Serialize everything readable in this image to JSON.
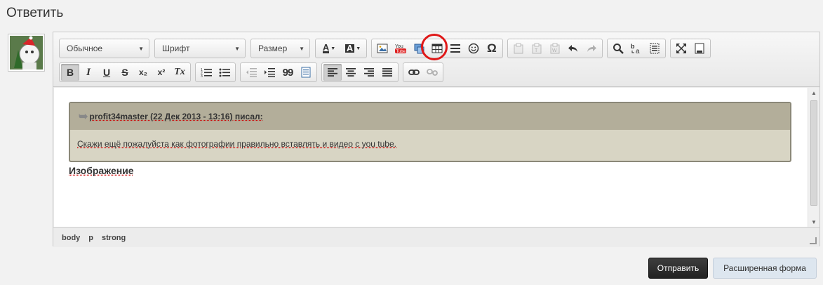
{
  "page": {
    "title": "Ответить"
  },
  "toolbar": {
    "format_combo": "Обычное",
    "font_combo": "Шрифт",
    "size_combo": "Размер",
    "bold_label": "B",
    "italic_label": "I",
    "underline_label": "U",
    "strike_label": "S",
    "subscript_label": "x₂",
    "superscript_label": "x²",
    "remove_format_label": "Tx",
    "blockquote_label": "99",
    "special_char_label": "Ω"
  },
  "editor": {
    "quote_author": "profit34master (22 Дек 2013 - 13:16) писал:",
    "quote_text": "Скажи ещё пожалуйста как фотографии правильно вставлять и видео с you tube.",
    "inserted_text": "Изображение"
  },
  "statusbar": {
    "path": [
      "body",
      "p",
      "strong"
    ]
  },
  "actions": {
    "send_label": "Отправить",
    "advanced_label": "Расширенная форма"
  },
  "colors": {
    "highlight_circle": "#e01818",
    "quote_bg": "#d8d5c4",
    "quote_header": "#b3ae9a",
    "send_bg": "#2b2b2b"
  }
}
